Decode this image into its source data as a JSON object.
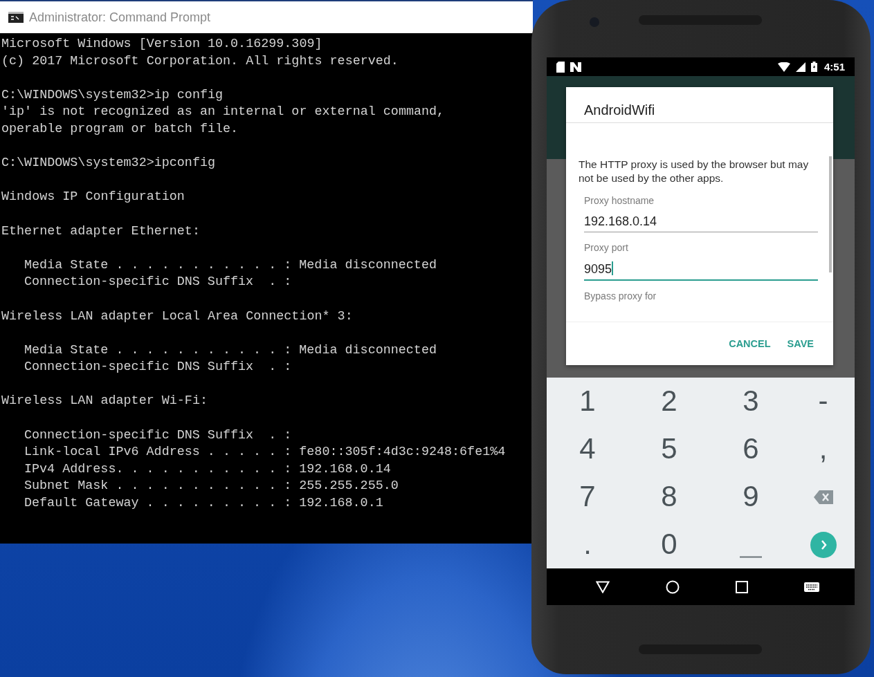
{
  "cmd_window": {
    "title": "Administrator: Command Prompt",
    "blocks": [
      {
        "indented": false,
        "lines": [
          "Microsoft Windows [Version 10.0.16299.309]",
          "(c) 2017 Microsoft Corporation. All rights reserved."
        ]
      },
      {
        "indented": false,
        "lines": [
          "C:\\WINDOWS\\system32>ip config",
          "'ip' is not recognized as an internal or external command,",
          "operable program or batch file."
        ]
      },
      {
        "indented": false,
        "lines": [
          "C:\\WINDOWS\\system32>ipconfig"
        ]
      },
      {
        "indented": false,
        "lines": [
          "Windows IP Configuration"
        ]
      },
      {
        "indented": false,
        "lines": [
          "Ethernet adapter Ethernet:"
        ]
      },
      {
        "indented": true,
        "lines": [
          "Media State . . . . . . . . . . . : Media disconnected",
          "Connection-specific DNS Suffix  . :"
        ]
      },
      {
        "indented": false,
        "lines": [
          "Wireless LAN adapter Local Area Connection* 3:"
        ]
      },
      {
        "indented": true,
        "lines": [
          "Media State . . . . . . . . . . . : Media disconnected",
          "Connection-specific DNS Suffix  . :"
        ]
      },
      {
        "indented": false,
        "lines": [
          "Wireless LAN adapter Wi-Fi:"
        ]
      },
      {
        "indented": true,
        "lines": [
          "Connection-specific DNS Suffix  . :",
          "Link-local IPv6 Address . . . . . : fe80::305f:4d3c:9248:6fe1%4",
          "IPv4 Address. . . . . . . . . . . : 192.168.0.14",
          "Subnet Mask . . . . . . . . . . . : 255.255.255.0",
          "Default Gateway . . . . . . . . . : 192.168.0.1"
        ]
      }
    ]
  },
  "phone": {
    "status_bar": {
      "time": "4:51"
    },
    "dialog": {
      "title": "AndroidWifi",
      "message": "The HTTP proxy is used by the browser but may not be used by the other apps.",
      "fields": [
        {
          "label": "Proxy hostname",
          "value": "192.168.0.14",
          "focused": false
        },
        {
          "label": "Proxy port",
          "value": "9095",
          "focused": true
        }
      ],
      "next_label": "Bypass proxy for",
      "buttons": [
        "CANCEL",
        "SAVE"
      ]
    },
    "keypad": [
      {
        "kind": "char",
        "text": "1"
      },
      {
        "kind": "char",
        "text": "2"
      },
      {
        "kind": "char",
        "text": "3"
      },
      {
        "kind": "char",
        "text": "-"
      },
      {
        "kind": "char",
        "text": "4"
      },
      {
        "kind": "char",
        "text": "5"
      },
      {
        "kind": "char",
        "text": "6"
      },
      {
        "kind": "char",
        "text": ","
      },
      {
        "kind": "char",
        "text": "7"
      },
      {
        "kind": "char",
        "text": "8"
      },
      {
        "kind": "char",
        "text": "9"
      },
      {
        "kind": "backspace"
      },
      {
        "kind": "char",
        "text": "."
      },
      {
        "kind": "char",
        "text": "0"
      },
      {
        "kind": "space"
      },
      {
        "kind": "enter"
      }
    ]
  }
}
